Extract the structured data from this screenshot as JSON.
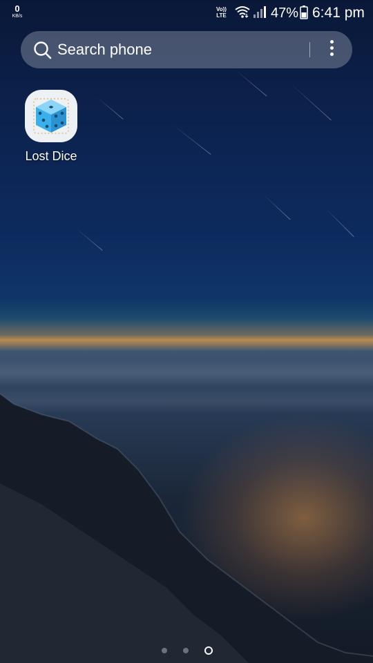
{
  "status_bar": {
    "net_speed_value": "0",
    "net_speed_unit": "KB/s",
    "volte_top": "Vo))",
    "volte_bottom": "LTE",
    "wifi_icon": "wifi-icon",
    "signal_icon": "cellular-signal-icon",
    "battery_percent": "47%",
    "battery_icon": "battery-icon",
    "time": "6:41 pm"
  },
  "search": {
    "placeholder": "Search phone",
    "icon": "search-icon",
    "menu_icon": "more-options-icon"
  },
  "apps": [
    {
      "label": "Lost Dice",
      "icon": "dice-icon"
    }
  ],
  "page_indicator": {
    "pages": 3,
    "current_page": 3
  },
  "colors": {
    "sky_top": "#0a1838",
    "sky_mid": "#0d2a5e",
    "horizon": "#b98a50",
    "dice_blue": "#3ab0ea"
  }
}
